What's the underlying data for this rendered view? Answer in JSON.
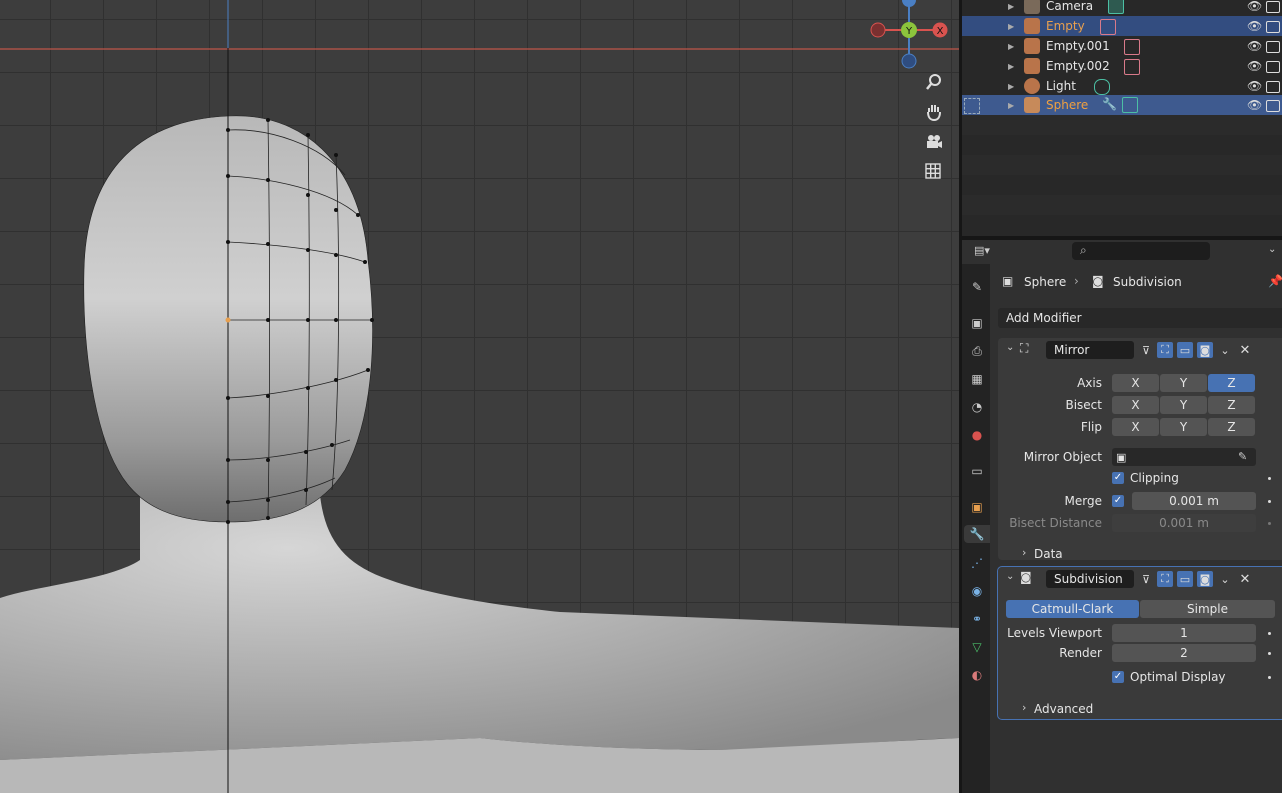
{
  "viewport": {
    "gizmo": {
      "x_label": "X",
      "y_label": "Y"
    },
    "nav_icons": [
      "zoom-icon",
      "hand-pan-icon",
      "camera-view-icon",
      "grid-toggle-icon"
    ]
  },
  "outliner": {
    "rows": [
      {
        "name": "Camera",
        "color": "#e6e6e6"
      },
      {
        "name": "Empty",
        "color": "#e8a04f"
      },
      {
        "name": "Empty.001",
        "color": "#e6e6e6"
      },
      {
        "name": "Empty.002",
        "color": "#e6e6e6"
      },
      {
        "name": "Light",
        "color": "#e6e6e6"
      },
      {
        "name": "Sphere",
        "color": "#f0a040"
      }
    ]
  },
  "properties": {
    "search_icon": "search-icon",
    "breadcrumb": {
      "object": "Sphere",
      "modifier": "Subdivision"
    },
    "add_modifier": "Add Modifier",
    "mirror": {
      "name": "Mirror",
      "axis_label": "Axis",
      "bisect_label": "Bisect",
      "flip_label": "Flip",
      "x": "X",
      "y": "Y",
      "z": "Z",
      "mirror_object_label": "Mirror Object",
      "clipping_label": "Clipping",
      "merge_label": "Merge",
      "merge_value": "0.001 m",
      "bisect_distance_label": "Bisect Distance",
      "bisect_distance_value": "0.001 m",
      "data_label": "Data"
    },
    "subdivision": {
      "name": "Subdivision",
      "catmull_clark": "Catmull-Clark",
      "simple": "Simple",
      "levels_viewport_label": "Levels Viewport",
      "levels_viewport_value": "1",
      "render_label": "Render",
      "render_value": "2",
      "optimal_display_label": "Optimal Display",
      "advanced_label": "Advanced"
    }
  },
  "colors": {
    "accent": "#4772b3",
    "selected_row": "#334d80",
    "viewport_bg": "#3d3d3d",
    "x_axis": "#d9534f",
    "y_axis": "#8cc43c",
    "z_axis": "#4a7fc4"
  }
}
